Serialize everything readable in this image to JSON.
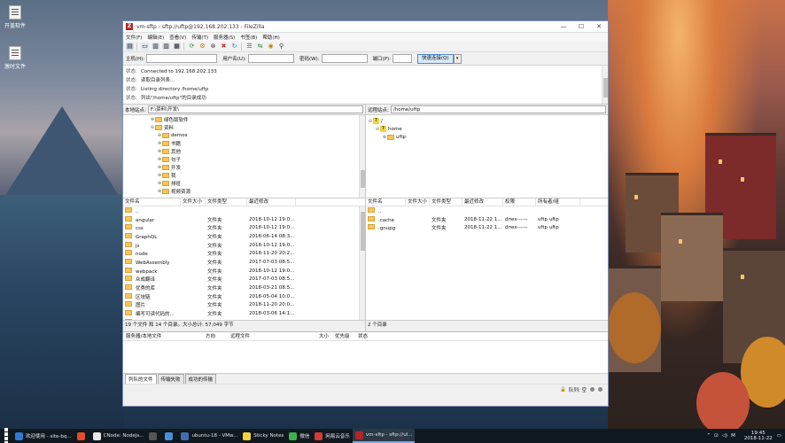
{
  "desktop": {
    "icons": [
      {
        "label": "开盖软件"
      },
      {
        "label": "激时文件"
      }
    ]
  },
  "window": {
    "title": "vm-sftp - sftp://uftp@192.168.202.133 - FileZilla",
    "app_icon": "Z",
    "controls": [
      "—",
      "☐",
      "✕"
    ]
  },
  "menu": [
    "文件(F)",
    "编辑(E)",
    "查看(V)",
    "传输(T)",
    "服务器(S)",
    "书签(B)",
    "帮助(H)"
  ],
  "quickconnect": {
    "host_label": "主机(H):",
    "user_label": "用户名(U):",
    "pass_label": "密码(W):",
    "port_label": "端口(P):",
    "button": "快速连接(Q)",
    "dropdown": "▾"
  },
  "log": [
    {
      "tag": "状态:",
      "text": "Connected to 192.168.202.133"
    },
    {
      "tag": "状态:",
      "text": "读取目录列表..."
    },
    {
      "tag": "状态:",
      "text": "Listing directory /home/uftp"
    },
    {
      "tag": "状态:",
      "text": "列出\"/home/uftp\"的目录成功"
    }
  ],
  "local": {
    "site_label": "本地站点:",
    "path": "F:\\资料\\开发\\",
    "tree": [
      {
        "exp": "⊕",
        "name": "绿色版软件"
      },
      {
        "exp": "⊖",
        "name": "资料"
      },
      {
        "exp": "⊕",
        "name": "demos"
      },
      {
        "exp": "⊕",
        "name": "书籍"
      },
      {
        "exp": "⊕",
        "name": "其他"
      },
      {
        "exp": "⊕",
        "name": "句子"
      },
      {
        "exp": "⊕",
        "name": "开发"
      },
      {
        "exp": "⊕",
        "name": "我"
      },
      {
        "exp": "⊕",
        "name": "排班"
      },
      {
        "exp": "⊕",
        "name": "视频资源"
      }
    ],
    "columns": [
      "文件名",
      "文件大小",
      "文件类型",
      "最近修改"
    ],
    "files": [
      {
        "name": "..",
        "size": "",
        "type": "",
        "modified": ""
      },
      {
        "name": "angular",
        "size": "",
        "type": "文件夹",
        "modified": "2018-10-12 19:0..."
      },
      {
        "name": "css",
        "size": "",
        "type": "文件夹",
        "modified": "2018-10-12 19:0..."
      },
      {
        "name": "GraphQL",
        "size": "",
        "type": "文件夹",
        "modified": "2018-06-14 08:3..."
      },
      {
        "name": "js",
        "size": "",
        "type": "文件夹",
        "modified": "2018-10-12 19:0..."
      },
      {
        "name": "node",
        "size": "",
        "type": "文件夹",
        "modified": "2018-11-20 20:2..."
      },
      {
        "name": "WebAssembly",
        "size": "",
        "type": "文件夹",
        "modified": "2017-07-03 08:5..."
      },
      {
        "name": "webpack",
        "size": "",
        "type": "文件夹",
        "modified": "2018-10-12 19:0..."
      },
      {
        "name": "众成翻译",
        "size": "",
        "type": "文件夹",
        "modified": "2017-07-03 08:5..."
      },
      {
        "name": "优秀的库",
        "size": "",
        "type": "文件夹",
        "modified": "2018-03-21 08:5..."
      },
      {
        "name": "区块链",
        "size": "",
        "type": "文件夹",
        "modified": "2018-05-04 10:0..."
      },
      {
        "name": "图片",
        "size": "",
        "type": "文件夹",
        "modified": "2018-11-20 20:0..."
      },
      {
        "name": "编写可读代码的...",
        "size": "",
        "type": "文件夹",
        "modified": "2018-03-06 14:1..."
      },
      {
        "name": "...",
        "size": "",
        "type": "文件夹",
        "modified": "2018-11-20 20:2..."
      }
    ],
    "status": "19 个文件 和 14 个目录。大小总计: 57,049 字节"
  },
  "remote": {
    "site_label": "远程站点:",
    "path": "/home/uftp",
    "tree": [
      {
        "exp": "⊖",
        "name": "/",
        "icon": "q",
        "indent": 0
      },
      {
        "exp": "⊖",
        "name": "home",
        "icon": "q",
        "indent": 1
      },
      {
        "exp": "⊕",
        "name": "uftp",
        "icon": "folder",
        "indent": 2
      }
    ],
    "columns": [
      "文件名",
      "文件大小",
      "文件类型",
      "最近修改",
      "权限",
      "所有者/组"
    ],
    "files": [
      {
        "name": "..",
        "size": "",
        "type": "",
        "modified": "",
        "perm": "",
        "owner": ""
      },
      {
        "name": ".cache",
        "size": "",
        "type": "文件夹",
        "modified": "2018-11-22 1...",
        "perm": "drwx------",
        "owner": "uftp uftp"
      },
      {
        "name": ".gnupg",
        "size": "",
        "type": "文件夹",
        "modified": "2018-11-22 1...",
        "perm": "drwx------",
        "owner": "uftp uftp"
      }
    ],
    "status": "2 个目录"
  },
  "queue": {
    "columns": [
      "服务器/本地文件",
      "方向",
      "远程文件",
      "大小",
      "优先级",
      "状态"
    ],
    "tabs": [
      "列队的文件",
      "传输失败",
      "成功的传输"
    ],
    "status_text": "队列: 空"
  },
  "taskbar": {
    "items": [
      {
        "label": "欢迎使用 - site-bq...",
        "color": "#2d7bd6"
      },
      {
        "label": "",
        "color": "#e44d26"
      },
      {
        "label": "CNode: Nodejs...",
        "color": "#e8e8e8"
      },
      {
        "label": "",
        "color": "#555555"
      },
      {
        "label": "",
        "color": "#4a8fd6"
      },
      {
        "label": "ubuntu-18 - VMw...",
        "color": "#3e6fb0"
      },
      {
        "label": "Sticky Notes",
        "color": "#f5d33a"
      },
      {
        "label": "微信",
        "color": "#3cb34a"
      },
      {
        "label": "网易云音乐",
        "color": "#d43c33"
      },
      {
        "label": "vm-sftp - sftp://ul...",
        "color": "#b4262a"
      }
    ],
    "time": "19:45",
    "date": "2018-11-22",
    "ime": "M"
  }
}
